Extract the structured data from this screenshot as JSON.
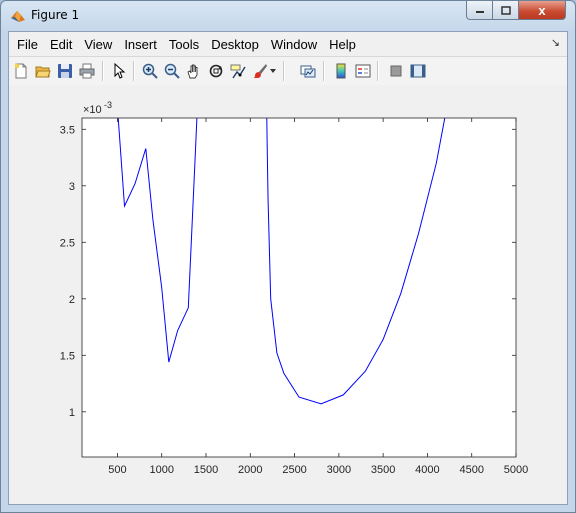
{
  "window": {
    "title": "Figure 1",
    "close_glyph": "x"
  },
  "menu": {
    "items": [
      "File",
      "Edit",
      "View",
      "Insert",
      "Tools",
      "Desktop",
      "Window",
      "Help"
    ],
    "overflow_glyph": "↘"
  },
  "toolbar": {
    "buttons": [
      "new-figure-icon",
      "open-file-icon",
      "save-icon",
      "print-icon",
      "edit-plot-arrow-icon",
      "zoom-in-icon",
      "zoom-out-icon",
      "pan-hand-icon",
      "rotate-3d-icon",
      "data-cursor-icon",
      "brush-icon",
      "link-plot-icon",
      "insert-colorbar-icon",
      "insert-legend-icon",
      "hide-plot-tools-icon",
      "show-plot-tools-icon"
    ]
  },
  "chart_data": {
    "type": "line",
    "title": "",
    "xlabel": "",
    "ylabel": "",
    "y_exponent_label": "×10",
    "y_exponent_power": "-3",
    "xlim": [
      100,
      5000
    ],
    "ylim": [
      0.6,
      3.6
    ],
    "xticks": [
      500,
      1000,
      1500,
      2000,
      2500,
      3000,
      3500,
      4000,
      4500,
      5000
    ],
    "yticks": [
      1,
      1.5,
      2,
      2.5,
      3,
      3.5
    ],
    "xtick_labels": [
      "500",
      "1000",
      "1500",
      "2000",
      "2500",
      "3000",
      "3500",
      "4000",
      "4500",
      "5000"
    ],
    "ytick_labels": [
      "1",
      "1.5",
      "2",
      "2.5",
      "3",
      "3.5"
    ],
    "grid": false,
    "series": [
      {
        "color": "#0000ff",
        "segments": [
          {
            "x": [
              500,
              580,
              700,
              820,
              900,
              1000,
              1080,
              1180,
              1300,
              1380,
              1420
            ],
            "y": [
              3.7,
              2.82,
              3.02,
              3.33,
              2.7,
              2.1,
              1.44,
              1.72,
              1.92,
              3.3,
              4.0
            ]
          },
          {
            "x": [
              2180,
              2190,
              2200,
              2230,
              2300,
              2380,
              2550,
              2800,
              3050,
              3300,
              3500,
              3700,
              3900,
              4100,
              4220
            ],
            "y": [
              4.0,
              3.4,
              2.9,
              2.0,
              1.52,
              1.34,
              1.13,
              1.07,
              1.15,
              1.36,
              1.64,
              2.05,
              2.58,
              3.2,
              3.7
            ]
          }
        ]
      }
    ]
  }
}
